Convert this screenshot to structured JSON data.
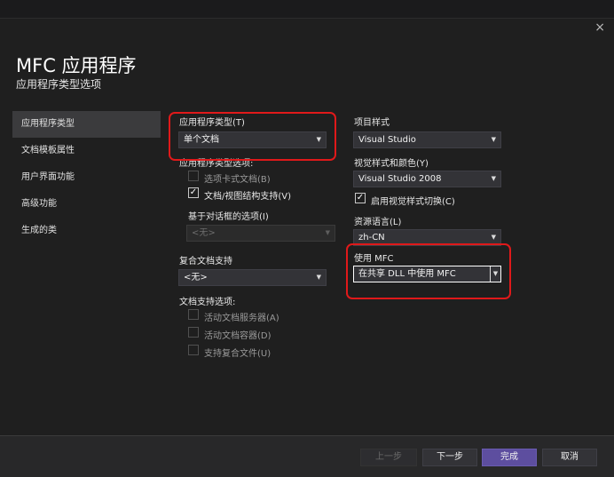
{
  "dialog": {
    "title": "MFC 应用程序",
    "subtitle": "应用程序类型选项",
    "close_glyph": "×"
  },
  "nav": {
    "items": [
      {
        "label": "应用程序类型",
        "active": true
      },
      {
        "label": "文档模板属性"
      },
      {
        "label": "用户界面功能"
      },
      {
        "label": "高级功能"
      },
      {
        "label": "生成的类"
      }
    ]
  },
  "left": {
    "app_type_label": "应用程序类型(T)",
    "app_type_value": "单个文档",
    "app_type_options_label": "应用程序类型选项:",
    "tabbed_docs_label": "选项卡式文档(B)",
    "tabbed_docs_checked": false,
    "docview_label": "文档/视图结构支持(V)",
    "docview_checked": true,
    "dialog_options_label": "基于对话框的选项(I)",
    "dialog_options_value": "<无>",
    "compound_label": "复合文档支持",
    "compound_value": "<无>",
    "doc_support_label": "文档支持选项:",
    "active_server_label": "活动文档服务器(A)",
    "active_container_label": "活动文档容器(D)",
    "compound_files_label": "支持复合文件(U)"
  },
  "right": {
    "project_style_label": "项目样式",
    "project_style_value": "Visual Studio",
    "visual_style_label": "视觉样式和颜色(Y)",
    "visual_style_value": "Visual Studio 2008",
    "visual_switch_label": "启用视觉样式切换(C)",
    "visual_switch_checked": true,
    "resource_lang_label": "资源语言(L)",
    "resource_lang_value": "zh-CN",
    "use_mfc_label": "使用 MFC",
    "use_mfc_value": "在共享 DLL 中使用 MFC"
  },
  "glyphs": {
    "dropdown_arrow": "▼",
    "check_mark": "✓"
  },
  "buttons": {
    "prev": "上一步",
    "next": "下一步",
    "finish": "完成",
    "cancel": "取消"
  },
  "colors": {
    "background": "#1f1f1f",
    "primary_button": "#5d4e9f",
    "highlight_box": "#e0191a"
  }
}
